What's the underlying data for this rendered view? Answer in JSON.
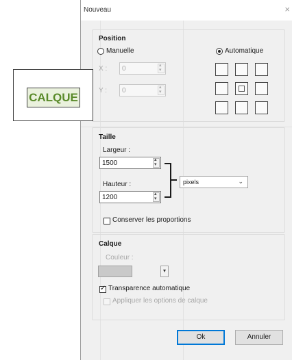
{
  "dialog": {
    "title": "Nouveau",
    "close_glyph": "×"
  },
  "position": {
    "legend": "Position",
    "manual_label": "Manuelle",
    "manual_selected": false,
    "automatic_label": "Automatique",
    "automatic_selected": true,
    "x_label": "X :",
    "x_value": "0",
    "y_label": "Y :",
    "y_value": "0",
    "anchor_selected": "center"
  },
  "size": {
    "legend": "Taille",
    "width_label": "Largeur :",
    "width_value": "1500",
    "height_label": "Hauteur :",
    "height_value": "1200",
    "unit_value": "pixels",
    "keep_ratio_label": "Conserver les proportions",
    "keep_ratio_checked": false
  },
  "layer": {
    "legend": "Calque",
    "color_label": "Couleur :",
    "color_value": "#c9c9c9",
    "transparency_label": "Transparence automatique",
    "transparency_checked": true,
    "apply_options_label": "Appliquer les options de calque",
    "apply_options_checked": false
  },
  "buttons": {
    "ok": "Ok",
    "cancel": "Annuler"
  },
  "callout": {
    "text": "CALQUE"
  },
  "icons": {
    "close": "close-icon",
    "dropdown": "chevron-down-icon",
    "spinner": "spinner-arrows-icon",
    "check": "checkmark-icon"
  },
  "colors": {
    "dialog_bg": "#f0f0f0",
    "accent": "#0078d7",
    "callout_text": "#5a8a2a",
    "callout_bg": "#eaf1dd"
  }
}
